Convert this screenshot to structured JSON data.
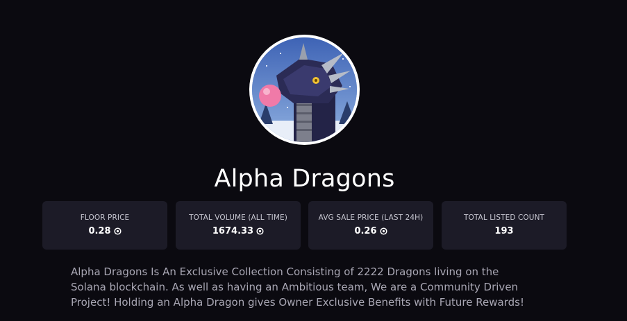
{
  "collection": {
    "name": "Alpha Dragons",
    "avatar_icon": "dragon-avatar",
    "description": "Alpha Dragons Is An Exclusive Collection Consisting of 2222 Dragons living on the Solana blockchain. As well as having an Ambitious team, We are a Community Driven Project! Holding an Alpha Dragon gives Owner Exclusive Benefits with Future Rewards!"
  },
  "stats": [
    {
      "label": "FLOOR PRICE",
      "value": "0.28",
      "icon": "sol-icon"
    },
    {
      "label": "TOTAL VOLUME (ALL TIME)",
      "value": "1674.33",
      "icon": "sol-icon"
    },
    {
      "label": "AVG SALE PRICE (LAST 24H)",
      "value": "0.26",
      "icon": "sol-icon"
    },
    {
      "label": "TOTAL LISTED COUNT",
      "value": "193",
      "icon": ""
    }
  ],
  "colors": {
    "background": "#0b0a10",
    "card": "#1c1b27",
    "text_muted": "#a9a7b4"
  }
}
